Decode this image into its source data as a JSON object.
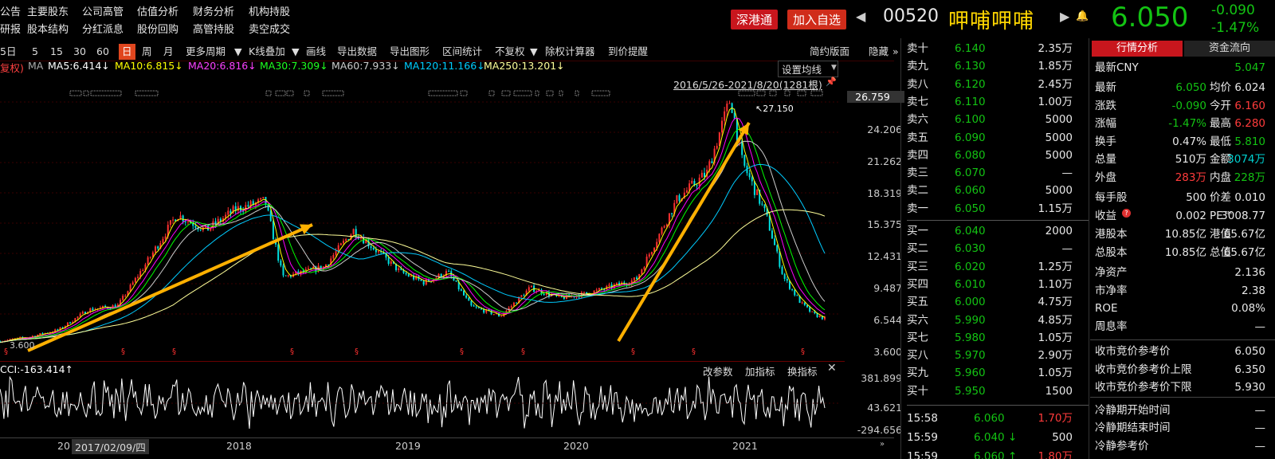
{
  "nav_row1": [
    "公告",
    "主要股东",
    "公司高管",
    "估值分析",
    "财务分析",
    "机构持股"
  ],
  "nav_row2": [
    "研报",
    "股本结构",
    "分红派息",
    "股份回购",
    "高管持股",
    "卖空成交"
  ],
  "header": {
    "tag1": "深港通",
    "tag2": "加入自选",
    "code": "00520",
    "name": "呷哺呷哺",
    "price": "6.050",
    "change": "-0.090",
    "change_pct": "-1.47%"
  },
  "toolbar": {
    "items": [
      "5日",
      "5",
      "15",
      "30",
      "60",
      "日",
      "周",
      "月",
      "更多周期",
      "K线叠加",
      "画线",
      "导出数据",
      "导出图形",
      "区间统计",
      "不复权",
      "除权计算器",
      "到价提醒"
    ],
    "right1": "简约版面",
    "right2": "隐藏"
  },
  "ma": {
    "prefix": "复权)",
    "ma": "MA",
    "ma5": "MA5:6.414↓",
    "ma10": "MA10:6.815↓",
    "ma20": "MA20:6.816↓",
    "ma30": "MA30:7.309↓",
    "ma60": "MA60:7.933↓",
    "ma120": "MA120:11.166↓",
    "ma250": "MA250:13.201↓",
    "setting": "设置均线",
    "range": "2016/5/26-2021/8/20(1281根)",
    "peak_label": "27.150",
    "low_label": "3.600"
  },
  "colors": {
    "ma5": "#ffffff",
    "ma10": "#ffff00",
    "ma20": "#ff00ff",
    "ma30": "#00ff00",
    "ma60": "#cccccc",
    "ma120": "#00ccff",
    "ma250": "#ffff99",
    "up": "#ff3030",
    "down": "#00e0e0",
    "arrow": "#ffb000"
  },
  "yaxis": [
    "26.759",
    "24.206",
    "21.262",
    "18.319",
    "15.375",
    "12.431",
    "9.487",
    "6.544",
    "3.600"
  ],
  "cci": {
    "label": "CCI:-163.414↑",
    "btn1": "改参数",
    "btn2": "加指标",
    "btn3": "换指标",
    "y": [
      "381.899",
      "43.621",
      "-294.656"
    ]
  },
  "xaxis": {
    "first": "20",
    "cursor": "2017/02/09/四",
    "years": [
      "2018",
      "2019",
      "2020",
      "2021"
    ]
  },
  "chart_data": {
    "type": "candlestick",
    "title": "",
    "range": "2016/5/26-2021/8/20",
    "bars": 1281,
    "price_path": [
      [
        0,
        3.9
      ],
      [
        0.05,
        4.3
      ],
      [
        0.1,
        5.0
      ],
      [
        0.15,
        6.9
      ],
      [
        0.2,
        7.3
      ],
      [
        0.25,
        11.5
      ],
      [
        0.3,
        16.0
      ],
      [
        0.35,
        14.5
      ],
      [
        0.4,
        16.5
      ],
      [
        0.45,
        17.3
      ],
      [
        0.48,
        10.0
      ],
      [
        0.55,
        11.0
      ],
      [
        0.6,
        14.5
      ],
      [
        0.68,
        10.5
      ],
      [
        0.72,
        9.5
      ],
      [
        0.76,
        10.5
      ],
      [
        0.8,
        7.2
      ],
      [
        0.85,
        6.3
      ],
      [
        0.9,
        9.0
      ],
      [
        0.95,
        8.0
      ],
      [
        1.0,
        8.5
      ],
      [
        1.08,
        9.8
      ],
      [
        1.15,
        17.5
      ],
      [
        1.2,
        20.0
      ],
      [
        1.24,
        27.15
      ],
      [
        1.26,
        21.0
      ],
      [
        1.3,
        16.0
      ],
      [
        1.33,
        10.0
      ],
      [
        1.36,
        7.5
      ],
      [
        1.38,
        6.5
      ],
      [
        1.4,
        6.05
      ]
    ]
  },
  "quotes": {
    "sell": [
      [
        "卖十",
        "6.140",
        "2.35万"
      ],
      [
        "卖九",
        "6.130",
        "1.85万"
      ],
      [
        "卖八",
        "6.120",
        "2.45万"
      ],
      [
        "卖七",
        "6.110",
        "1.00万"
      ],
      [
        "卖六",
        "6.100",
        "5000"
      ],
      [
        "卖五",
        "6.090",
        "5000"
      ],
      [
        "卖四",
        "6.080",
        "5000"
      ],
      [
        "卖三",
        "6.070",
        "—"
      ],
      [
        "卖二",
        "6.060",
        "5000"
      ],
      [
        "卖一",
        "6.050",
        "1.15万"
      ]
    ],
    "buy": [
      [
        "买一",
        "6.040",
        "2000"
      ],
      [
        "买二",
        "6.030",
        "—"
      ],
      [
        "买三",
        "6.020",
        "1.25万"
      ],
      [
        "买四",
        "6.010",
        "1.10万"
      ],
      [
        "买五",
        "6.000",
        "4.75万"
      ],
      [
        "买六",
        "5.990",
        "4.85万"
      ],
      [
        "买七",
        "5.980",
        "1.05万"
      ],
      [
        "买八",
        "5.970",
        "2.90万"
      ],
      [
        "买九",
        "5.960",
        "1.05万"
      ],
      [
        "买十",
        "5.950",
        "1500"
      ]
    ],
    "ticks": [
      [
        "15:58",
        "6.060",
        "1.70万"
      ],
      [
        "15:59",
        "6.040 ↓",
        "500"
      ],
      [
        "15:59",
        "6.060 ↑",
        "1.80万"
      ]
    ]
  },
  "right": {
    "tab1": "行情分析",
    "tab2": "资金流向",
    "cny_label": "最新CNY",
    "cny": "5.047",
    "rows": [
      [
        "最新",
        "6.050",
        "均价",
        "6.024"
      ],
      [
        "涨跌",
        "-0.090",
        "今开",
        "6.160"
      ],
      [
        "涨幅",
        "-1.47%",
        "最高",
        "6.280"
      ],
      [
        "换手",
        "0.47%",
        "最低",
        "5.810"
      ],
      [
        "总量",
        "510万",
        "金额",
        "3074万"
      ],
      [
        "外盘",
        "283万",
        "内盘",
        "228万"
      ]
    ],
    "rows2": [
      [
        "每手股",
        "500",
        "价差",
        "0.010"
      ],
      [
        "收益",
        "0.002",
        "PE™",
        "3008.77"
      ],
      [
        "港股本",
        "10.85亿",
        "港值",
        "65.67亿"
      ],
      [
        "总股本",
        "10.85亿",
        "总值",
        "65.67亿"
      ]
    ],
    "rows3": [
      [
        "净资产",
        "2.136"
      ],
      [
        "市净率",
        "2.38"
      ],
      [
        "ROE",
        "0.08%"
      ],
      [
        "周息率",
        "—"
      ]
    ],
    "rows4": [
      [
        "收市竞价参考价",
        "6.050"
      ],
      [
        "收市竞价参考价上限",
        "6.350"
      ],
      [
        "收市竞价参考价下限",
        "5.930"
      ],
      [
        "冷静期开始时间",
        "—"
      ],
      [
        "冷静期结束时间",
        "—"
      ],
      [
        "冷静参考价",
        "—"
      ]
    ]
  }
}
